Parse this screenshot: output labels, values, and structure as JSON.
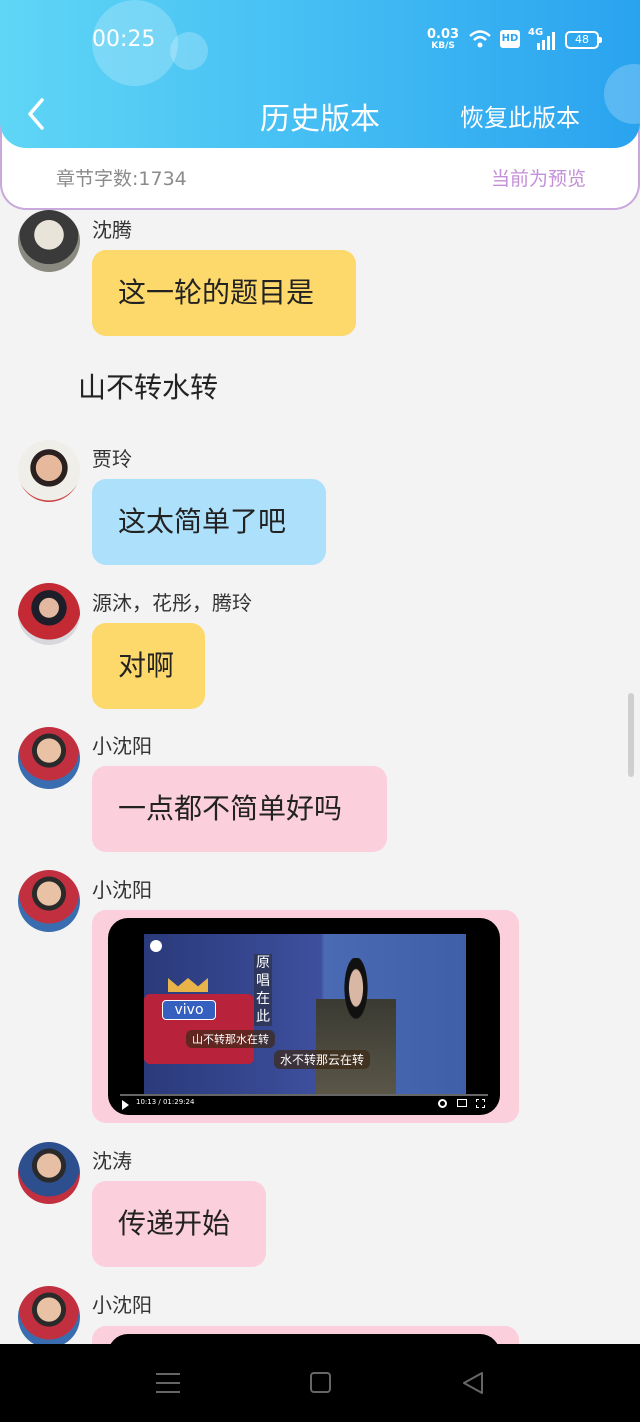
{
  "status": {
    "time": "00:25",
    "net_speed_value": "0.03",
    "net_speed_unit": "KB/S",
    "wifi_icon": "wifi-icon",
    "hd_label": "HD",
    "signal_label": "4G",
    "battery": "48"
  },
  "header": {
    "back_icon": "chevron-left-icon",
    "title": "历史版本",
    "restore": "恢复此版本"
  },
  "info": {
    "word_count": "章节字数:1734",
    "preview": "当前为预览"
  },
  "messages": [
    {
      "name": "沈腾",
      "text": "这一轮的题目是"
    },
    {
      "name": "贾玲",
      "text": "这太简单了吧"
    },
    {
      "name": "源沐，花彤，腾玲",
      "text": "对啊"
    },
    {
      "name": "小沈阳",
      "text": "一点都不简单好吗"
    },
    {
      "name": "小沈阳",
      "video": {
        "time": "10:13 / 01:29:24",
        "vertical_caption": "原唱在此",
        "caption1": "山不转那水在转",
        "caption2": "水不转那云在转",
        "logo": "vivo"
      }
    },
    {
      "name": "沈涛",
      "text": "传递开始"
    },
    {
      "name": "小沈阳"
    }
  ],
  "narration": "山不转水转",
  "colors": {
    "accent": "#2aa3ef",
    "preview": "#c48fd8",
    "yellow_bubble": "#fdd86a",
    "blue_bubble": "#ade0fb",
    "pink_bubble": "#fbcfdc"
  }
}
